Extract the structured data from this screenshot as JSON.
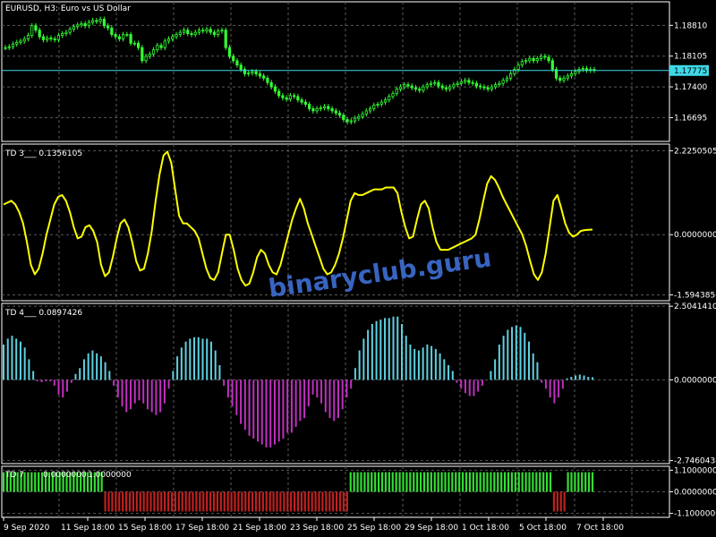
{
  "colors": {
    "background": "#000000",
    "grid": "#5a5a5a",
    "axis": "#ffffff",
    "candle": "#33ff33",
    "price_line": "#3fd8e8",
    "price_badge": "#3fd8e8",
    "td3": "#ffff00",
    "td4_pos": "#5fd0e0",
    "td4_neg": "#c030c0",
    "td7_pos": "#33dd33",
    "td7_neg": "#c02020",
    "watermark": "#3f6fd6"
  },
  "watermark": "binaryclub.guru",
  "x_labels": [
    "9 Sep 2020",
    "11 Sep 18:00",
    "15 Sep 18:00",
    "17 Sep 18:00",
    "21 Sep 18:00",
    "23 Sep 18:00",
    "25 Sep 18:00",
    "29 Sep 18:00",
    "1 Oct 18:00",
    "5 Oct 18:00",
    "7 Oct 18:00"
  ],
  "chart_data": [
    {
      "type": "line",
      "subtype": "candlestick",
      "title": "EURUSD, H3:  Euro vs US Dollar",
      "y_ticks": [
        "1.18810",
        "1.18105",
        "1.17400",
        "1.16695"
      ],
      "y_tick_values": [
        1.1881,
        1.18105,
        1.174,
        1.16695
      ],
      "ylim": [
        1.1615,
        1.1935
      ],
      "current_price": "1.17775",
      "current_price_value": 1.17775,
      "series": [
        {
          "values": [
            1.183,
            1.1832,
            1.1838,
            1.1842,
            1.1845,
            1.185,
            1.1858,
            1.188,
            1.187,
            1.1855,
            1.1848,
            1.1852,
            1.185,
            1.1848,
            1.1858,
            1.1862,
            1.1865,
            1.1872,
            1.1878,
            1.1882,
            1.1885,
            1.188,
            1.1888,
            1.1892,
            1.189,
            1.1895,
            1.188,
            1.1875,
            1.186,
            1.1855,
            1.185,
            1.186,
            1.186,
            1.184,
            1.184,
            1.183,
            1.18,
            1.181,
            1.1815,
            1.1825,
            1.1835,
            1.183,
            1.1845,
            1.185,
            1.1855,
            1.186,
            1.1865,
            1.187,
            1.1862,
            1.186,
            1.1865,
            1.187,
            1.1868,
            1.1872,
            1.1865,
            1.186,
            1.1868,
            1.187,
            1.183,
            1.181,
            1.18,
            1.179,
            1.178,
            1.177,
            1.1772,
            1.1775,
            1.177,
            1.1765,
            1.176,
            1.175,
            1.174,
            1.173,
            1.172,
            1.1715,
            1.1712,
            1.172,
            1.1718,
            1.171,
            1.1705,
            1.17,
            1.169,
            1.1685,
            1.169,
            1.1692,
            1.1695,
            1.169,
            1.1685,
            1.168,
            1.1675,
            1.1665,
            1.166,
            1.1662,
            1.1668,
            1.1672,
            1.1678,
            1.1685,
            1.169,
            1.1698,
            1.17,
            1.1705,
            1.171,
            1.1718,
            1.1725,
            1.1735,
            1.174,
            1.1745,
            1.1742,
            1.1738,
            1.1735,
            1.1732,
            1.174,
            1.1745,
            1.1748,
            1.175,
            1.1742,
            1.1738,
            1.1735,
            1.174,
            1.1745,
            1.1748,
            1.1752,
            1.1755,
            1.175,
            1.1748,
            1.1742,
            1.174,
            1.1738,
            1.1735,
            1.174,
            1.1745,
            1.1748,
            1.1755,
            1.176,
            1.177,
            1.178,
            1.179,
            1.1798,
            1.18,
            1.1805,
            1.18,
            1.1805,
            1.181,
            1.1808,
            1.18,
            1.178,
            1.176,
            1.1755,
            1.176,
            1.1765,
            1.177,
            1.1775,
            1.178,
            1.1782,
            1.1778,
            1.178,
            1.1778
          ]
        }
      ]
    },
    {
      "type": "line",
      "title": "TD 3___ 0.1356105",
      "y_ticks": [
        "2.2250505",
        "0.0000000",
        "-1.5943850"
      ],
      "ylim": [
        -1.75,
        2.4
      ],
      "series": [
        {
          "values": [
            0.8,
            0.85,
            0.9,
            0.8,
            0.6,
            0.3,
            -0.2,
            -0.8,
            -1.05,
            -0.9,
            -0.5,
            0.0,
            0.4,
            0.8,
            1.0,
            1.05,
            0.9,
            0.6,
            0.2,
            -0.1,
            -0.05,
            0.2,
            0.25,
            0.1,
            -0.2,
            -0.8,
            -1.1,
            -1.0,
            -0.6,
            -0.1,
            0.3,
            0.4,
            0.2,
            -0.2,
            -0.7,
            -0.95,
            -0.9,
            -0.5,
            0.1,
            0.9,
            1.6,
            2.1,
            2.2,
            1.9,
            1.2,
            0.5,
            0.3,
            0.3,
            0.2,
            0.1,
            -0.1,
            -0.5,
            -0.9,
            -1.15,
            -1.2,
            -1.0,
            -0.5,
            0.0,
            0.0,
            -0.4,
            -0.9,
            -1.2,
            -1.35,
            -1.3,
            -1.0,
            -0.6,
            -0.4,
            -0.5,
            -0.8,
            -1.0,
            -1.05,
            -0.8,
            -0.4,
            0.0,
            0.4,
            0.7,
            0.95,
            0.7,
            0.3,
            0.0,
            -0.3,
            -0.6,
            -0.9,
            -1.05,
            -1.0,
            -0.8,
            -0.5,
            -0.1,
            0.4,
            0.9,
            1.1,
            1.05,
            1.05,
            1.1,
            1.15,
            1.2,
            1.2,
            1.2,
            1.25,
            1.25,
            1.25,
            1.1,
            0.6,
            0.2,
            -0.1,
            -0.05,
            0.4,
            0.8,
            0.9,
            0.7,
            0.2,
            -0.2,
            -0.4,
            -0.4,
            -0.4,
            -0.35,
            -0.3,
            -0.25,
            -0.2,
            -0.15,
            -0.1,
            0.0,
            0.4,
            0.9,
            1.35,
            1.55,
            1.45,
            1.25,
            1.0,
            0.8,
            0.6,
            0.4,
            0.2,
            0.0,
            -0.3,
            -0.7,
            -1.05,
            -1.2,
            -1.0,
            -0.5,
            0.2,
            0.9,
            1.05,
            0.7,
            0.3,
            0.05,
            -0.05,
            0.0,
            0.1,
            0.12,
            0.13,
            0.135
          ]
        }
      ]
    },
    {
      "type": "bar",
      "title": "TD 4___ 0.0897426",
      "y_ticks": [
        "2.5041410",
        "0.0000000",
        "-2.7460434"
      ],
      "ylim": [
        -2.85,
        2.6
      ],
      "series": [
        {
          "values": [
            1.2,
            1.4,
            1.5,
            1.4,
            1.3,
            1.1,
            0.7,
            0.3,
            -0.05,
            -0.08,
            -0.05,
            -0.05,
            -0.2,
            -0.5,
            -0.6,
            -0.4,
            -0.1,
            0.2,
            0.4,
            0.7,
            0.9,
            1.0,
            0.9,
            0.8,
            0.6,
            0.3,
            -0.2,
            -0.6,
            -0.9,
            -1.1,
            -1.0,
            -0.8,
            -0.7,
            -0.8,
            -1.0,
            -1.1,
            -1.2,
            -1.1,
            -0.8,
            -0.3,
            0.3,
            0.8,
            1.1,
            1.3,
            1.4,
            1.45,
            1.45,
            1.4,
            1.4,
            1.3,
            1.0,
            0.5,
            -0.2,
            -0.6,
            -0.9,
            -1.2,
            -1.5,
            -1.7,
            -1.9,
            -2.0,
            -2.1,
            -2.2,
            -2.3,
            -2.3,
            -2.2,
            -2.1,
            -2.0,
            -1.8,
            -1.8,
            -1.6,
            -1.4,
            -1.3,
            -0.9,
            -0.5,
            -0.6,
            -0.8,
            -1.1,
            -1.3,
            -1.4,
            -1.3,
            -1.0,
            -0.6,
            -0.3,
            0.4,
            1.0,
            1.4,
            1.7,
            1.9,
            2.0,
            2.05,
            2.1,
            2.1,
            2.15,
            2.15,
            1.9,
            1.5,
            1.2,
            1.05,
            1.0,
            1.1,
            1.2,
            1.15,
            1.05,
            0.9,
            0.7,
            0.5,
            0.3,
            -0.1,
            -0.3,
            -0.45,
            -0.55,
            -0.55,
            -0.4,
            -0.2,
            0.0,
            0.3,
            0.7,
            1.2,
            1.5,
            1.7,
            1.8,
            1.85,
            1.8,
            1.6,
            1.3,
            0.9,
            0.6,
            -0.1,
            -0.3,
            -0.6,
            -0.8,
            -0.6,
            -0.3,
            0.05,
            0.1,
            0.15,
            0.18,
            0.15,
            0.1,
            0.09
          ]
        }
      ]
    },
    {
      "type": "bar",
      "title": "TD 7",
      "legend": [
        "0.0000000",
        "1.0000000"
      ],
      "y_ticks": [
        "1.1000000",
        "0.0000000",
        "-1.1000000"
      ],
      "ylim": [
        -1.3,
        1.3
      ],
      "series": [
        {
          "values": [
            1,
            1,
            1,
            1,
            1,
            1,
            1,
            1,
            1,
            1,
            1,
            1,
            1,
            1,
            1,
            1,
            1,
            1,
            1,
            1,
            1,
            1,
            1,
            1,
            1,
            1,
            1,
            1,
            1,
            -1,
            -1,
            -1,
            -1,
            -1,
            -1,
            -1,
            -1,
            -1,
            -1,
            -1,
            -1,
            -1,
            -1,
            -1,
            -1,
            -1,
            -1,
            -1,
            -1,
            -1,
            -1,
            -1,
            -1,
            -1,
            -1,
            -1,
            -1,
            -1,
            -1,
            -1,
            -1,
            -1,
            -1,
            -1,
            -1,
            -1,
            -1,
            -1,
            -1,
            -1,
            -1,
            -1,
            -1,
            -1,
            -1,
            -1,
            -1,
            -1,
            -1,
            -1,
            -1,
            -1,
            -1,
            -1,
            -1,
            -1,
            -1,
            -1,
            -1,
            -1,
            -1,
            -1,
            -1,
            -1,
            -1,
            -1,
            -1,
            -1,
            -1,
            1,
            1,
            1,
            1,
            1,
            1,
            1,
            1,
            1,
            1,
            1,
            1,
            1,
            1,
            1,
            1,
            1,
            1,
            1,
            1,
            1,
            1,
            1,
            1,
            1,
            1,
            1,
            1,
            1,
            1,
            1,
            1,
            1,
            1,
            1,
            1,
            1,
            1,
            1,
            1,
            1,
            1,
            1,
            1,
            1,
            1,
            1,
            1,
            1,
            1,
            1,
            1,
            1,
            1,
            1,
            1,
            1,
            1,
            -1,
            -1,
            -1,
            -1,
            1,
            1,
            1,
            1,
            1,
            1,
            1,
            1
          ]
        }
      ]
    }
  ]
}
